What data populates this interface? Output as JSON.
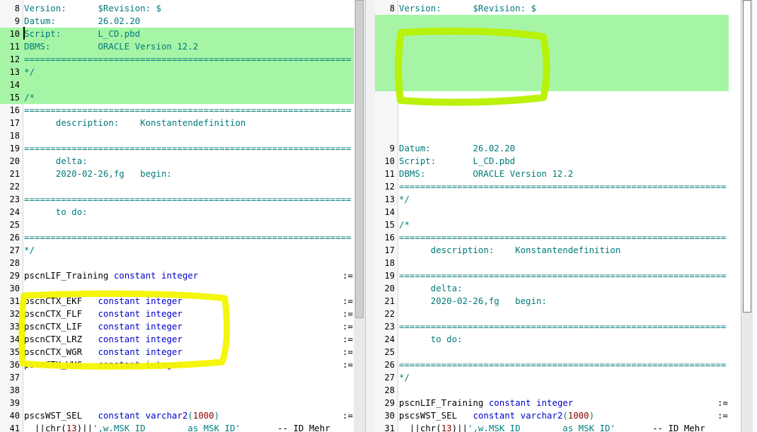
{
  "left": {
    "lines": [
      {
        "n": "8",
        "text": "Version:      $Revision: $"
      },
      {
        "n": "9",
        "text": "Datum:        26.02.20"
      },
      {
        "n": "10",
        "text": "Script:       L_CD.pbd",
        "added": true
      },
      {
        "n": "11",
        "text": "DBMS:         ORACLE Version 12.2",
        "added": true
      },
      {
        "n": "12",
        "text": "==============================================================",
        "added": true
      },
      {
        "n": "13",
        "text": "*/",
        "added": true
      },
      {
        "n": "14",
        "text": "",
        "added": true
      },
      {
        "n": "15",
        "text": "/*",
        "added": true
      },
      {
        "n": "16",
        "text": "=============================================================="
      },
      {
        "n": "17",
        "text": "      description:    Konstantendefinition"
      },
      {
        "n": "18",
        "text": ""
      },
      {
        "n": "19",
        "text": "=============================================================="
      },
      {
        "n": "20",
        "text": "      delta:"
      },
      {
        "n": "21",
        "text": "      2020-02-26,fg   begin:"
      },
      {
        "n": "22",
        "text": ""
      },
      {
        "n": "23",
        "text": "=============================================================="
      },
      {
        "n": "24",
        "text": "      to do:"
      },
      {
        "n": "25",
        "text": ""
      },
      {
        "n": "26",
        "text": "=============================================================="
      },
      {
        "n": "27",
        "text": "*/"
      },
      {
        "n": "28",
        "text": ""
      },
      {
        "n": "29",
        "text": "pscnLIF_Training constant integer",
        "code": true,
        "tail": ":="
      },
      {
        "n": "30",
        "text": ""
      },
      {
        "n": "31",
        "text": "pscnCTX_EKF   constant integer",
        "code": true,
        "tail": ":="
      },
      {
        "n": "32",
        "text": "pscnCTX_FLF   constant integer",
        "code": true,
        "tail": ":="
      },
      {
        "n": "33",
        "text": "pscnCTX_LIF   constant integer",
        "code": true,
        "tail": ":="
      },
      {
        "n": "34",
        "text": "pscnCTX_LRZ   constant integer",
        "code": true,
        "tail": ":="
      },
      {
        "n": "35",
        "text": "pscnCTX_WGR   constant integer",
        "code": true,
        "tail": ":="
      },
      {
        "n": "36",
        "text": "pscnCTX_WUG   constant integer",
        "code": true,
        "tail": ":="
      },
      {
        "n": "37",
        "text": ""
      },
      {
        "n": "38",
        "text": ""
      },
      {
        "n": "39",
        "text": ""
      },
      {
        "n": "40",
        "text": "pscsWST_SEL   constant varchar2(1000)",
        "code": true,
        "tail": ":="
      },
      {
        "n": "41",
        "text": "  ||chr(13)||',w.MSK_ID        as MSK_ID'       -- ID Mehr"
      }
    ]
  },
  "right": {
    "lines": [
      {
        "n": "8",
        "text": "Version:      $Revision: $"
      },
      {
        "n": "",
        "text": "",
        "added": true
      },
      {
        "n": "",
        "text": "",
        "added": true
      },
      {
        "n": "",
        "text": "",
        "added": true
      },
      {
        "n": "",
        "text": "",
        "added": true
      },
      {
        "n": "",
        "text": "",
        "added": true
      },
      {
        "n": "",
        "text": "",
        "added": true
      },
      {
        "n": "",
        "text": ""
      },
      {
        "n": "",
        "text": ""
      },
      {
        "n": "",
        "text": ""
      },
      {
        "n": "",
        "text": ""
      },
      {
        "n": "9",
        "text": "Datum:        26.02.20"
      },
      {
        "n": "10",
        "text": "Script:       L_CD.pbd"
      },
      {
        "n": "11",
        "text": "DBMS:         ORACLE Version 12.2"
      },
      {
        "n": "12",
        "text": "=============================================================="
      },
      {
        "n": "13",
        "text": "*/"
      },
      {
        "n": "14",
        "text": ""
      },
      {
        "n": "15",
        "text": "/*"
      },
      {
        "n": "16",
        "text": "=============================================================="
      },
      {
        "n": "17",
        "text": "      description:    Konstantendefinition"
      },
      {
        "n": "18",
        "text": ""
      },
      {
        "n": "19",
        "text": "=============================================================="
      },
      {
        "n": "20",
        "text": "      delta:"
      },
      {
        "n": "21",
        "text": "      2020-02-26,fg   begin:"
      },
      {
        "n": "22",
        "text": ""
      },
      {
        "n": "23",
        "text": "=============================================================="
      },
      {
        "n": "24",
        "text": "      to do:"
      },
      {
        "n": "25",
        "text": ""
      },
      {
        "n": "26",
        "text": "=============================================================="
      },
      {
        "n": "27",
        "text": "*/"
      },
      {
        "n": "28",
        "text": ""
      },
      {
        "n": "29",
        "text": "pscnLIF_Training constant integer",
        "code": true,
        "tail": ":="
      },
      {
        "n": "30",
        "text": "pscsWST_SEL   constant varchar2(1000)",
        "code": true,
        "tail": ":="
      },
      {
        "n": "31",
        "text": "  ||chr(13)||',w.MSK_ID        as MSK_ID'       -- ID Mehr"
      }
    ]
  },
  "colors": {
    "added_bg": "#a6f5a6",
    "comment": "#007a7a",
    "keyword": "#0000c8",
    "highlighter": "#f4f400"
  }
}
